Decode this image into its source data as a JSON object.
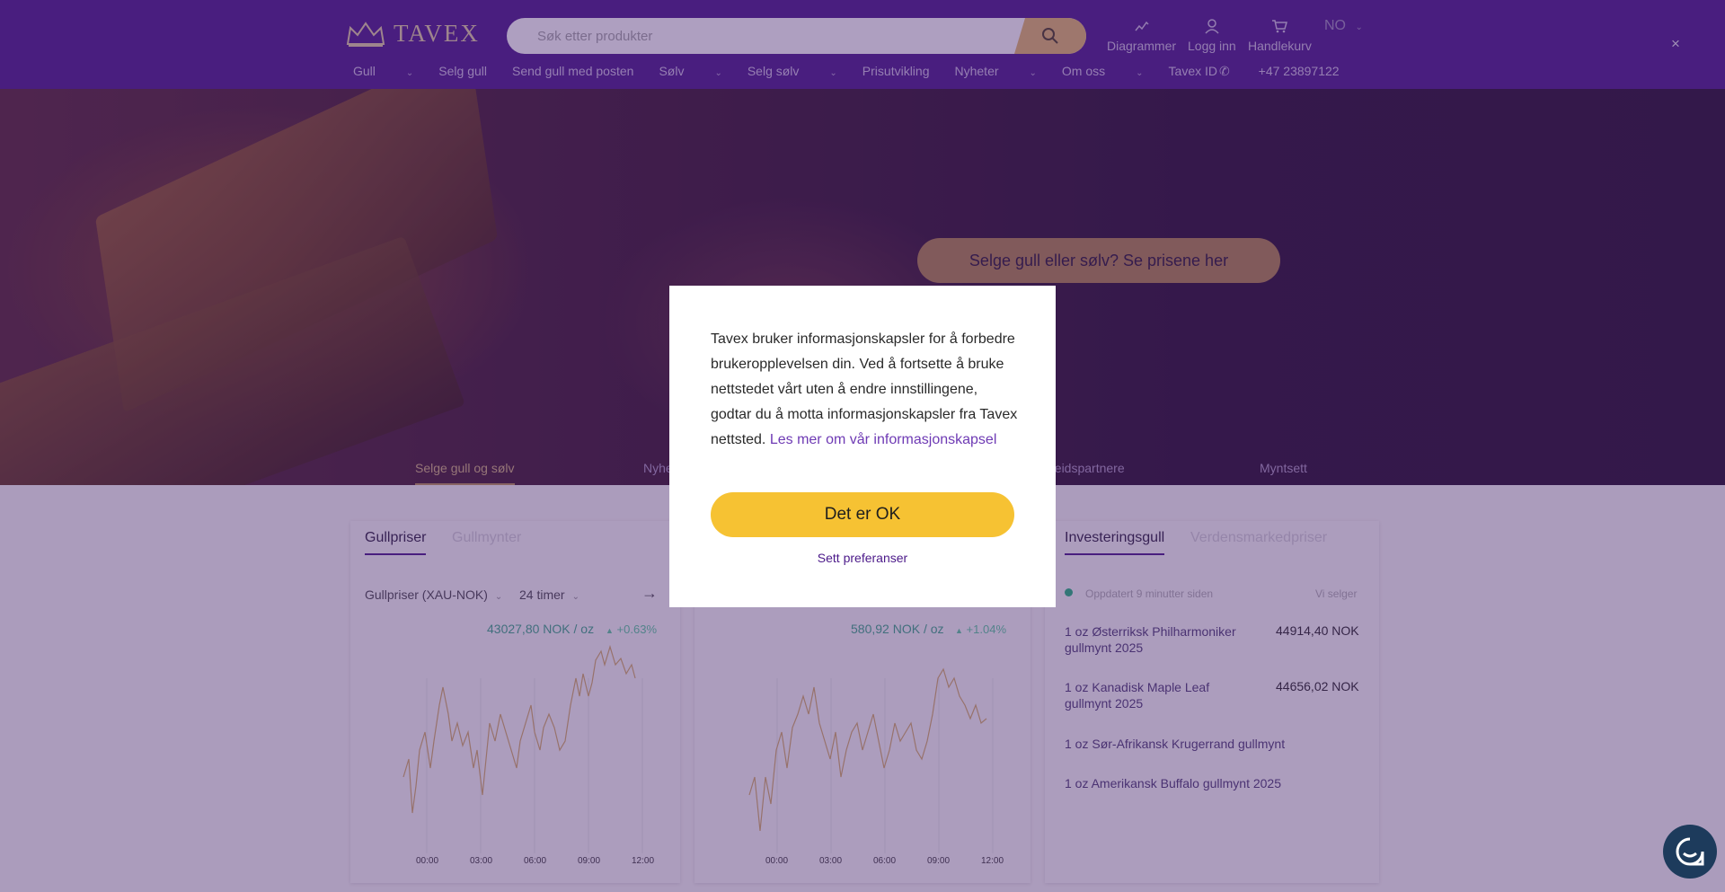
{
  "header": {
    "logo_text": "TAVEX",
    "search_placeholder": "Søk etter produkter",
    "actions": [
      {
        "label": "Diagrammer",
        "icon": "chart-icon"
      },
      {
        "label": "Logg inn",
        "icon": "user-icon"
      },
      {
        "label": "Handlekurv",
        "icon": "cart-icon"
      }
    ],
    "language": "NO",
    "close_symbol": "×"
  },
  "nav": {
    "items": [
      "Gull",
      "Selg gull",
      "Send gull med posten",
      "Sølv",
      "Selg sølv",
      "Prisutvikling",
      "Nyheter",
      "Om oss",
      "Tavex ID"
    ],
    "phone": "+47 23897122"
  },
  "hero": {
    "cta": "Selge gull eller sølv? Se prisene her",
    "tabs": [
      "Selge gull og sølv",
      "Nyhe",
      "beidspartnere",
      "Myntsett"
    ]
  },
  "gold_card": {
    "tabs": [
      "Gullpriser",
      "Gullmynter"
    ],
    "selector": "Gullpriser (XAU-NOK)",
    "period": "24 timer",
    "price": "43027,80 NOK / oz",
    "change": "+0.63%",
    "x_ticks": [
      "00:00",
      "03:00",
      "06:00",
      "09:00",
      "12:00"
    ]
  },
  "silver_card": {
    "price": "580,92 NOK / oz",
    "change": "+1.04%",
    "x_ticks": [
      "00:00",
      "03:00",
      "06:00",
      "09:00",
      "12:00"
    ]
  },
  "invest_card": {
    "tabs": [
      "Investeringsgull",
      "Verdensmarkedpriser"
    ],
    "status": "Oppdatert 9 minutter siden",
    "column_header": "Vi selger",
    "products": [
      {
        "name": "1 oz Østerriksk Philharmoniker gullmynt 2025",
        "price": "44914,40 NOK"
      },
      {
        "name": "1 oz Kanadisk Maple Leaf gullmynt 2025",
        "price": "44656,02 NOK"
      },
      {
        "name": "1 oz Sør-Afrikansk Krugerrand gullmynt",
        "price": ""
      },
      {
        "name": "1 oz Amerikansk Buffalo gullmynt 2025",
        "price": ""
      }
    ]
  },
  "cookie_modal": {
    "text": "Tavex bruker informasjonskapsler for å forbedre brukeropplevelsen din. Ved å fortsette å bruke nettstedet vårt uten å endre innstillingene, godtar du å motta informasjonskapsler fra Tavex nettsted.",
    "link": "Les mer om vår informasjonskapsel",
    "ok_button": "Det er OK",
    "preferences": "Sett preferanser"
  }
}
